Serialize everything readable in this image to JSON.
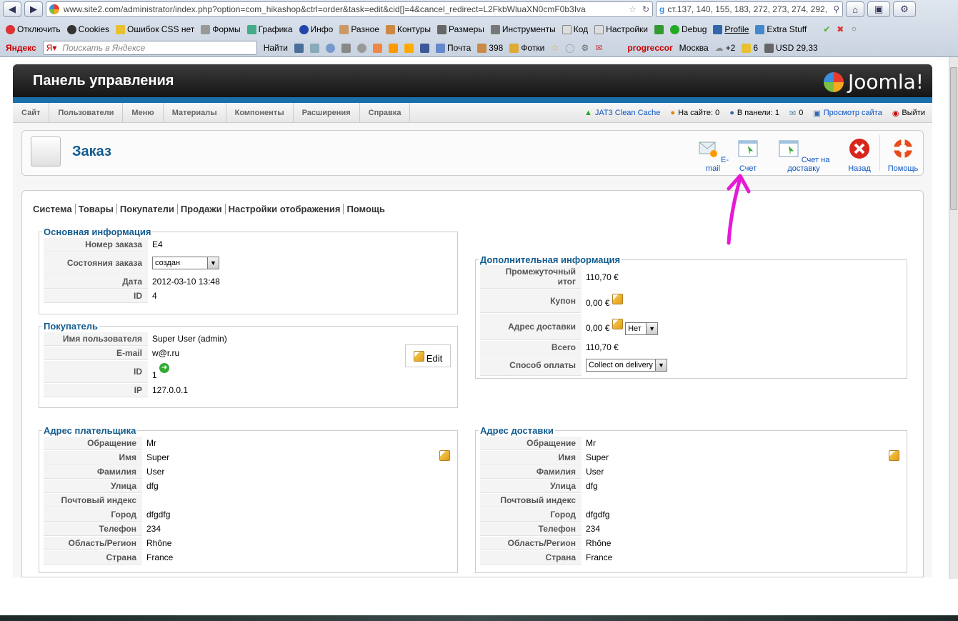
{
  "browser": {
    "url": "www.site2.com/administrator/index.php?option=com_hikashop&ctrl=order&task=edit&cid[]=4&cancel_redirect=L2FkbWluaXN0cmF0b3Iva",
    "search_value": "ст.137, 140, 155, 183, 272, 273, 274, 292,",
    "devbar": [
      "Отключить",
      "Cookies",
      "Ошибок CSS нет",
      "Формы",
      "Графика",
      "Инфо",
      "Разное",
      "Контуры",
      "Размеры",
      "Инструменты",
      "Код",
      "Настройки",
      "Debug",
      "Profile",
      "Extra Stuff"
    ],
    "yandex": {
      "brand": "Яндекс",
      "search_placeholder": "Поискать в Яндексе",
      "find_label": "Найти",
      "mail_label": "Почта",
      "mail_count": "398",
      "photos_label": "Фотки",
      "user": "progreccor",
      "city": "Москва",
      "weather": "+2",
      "counter": "6",
      "currency": "USD 29,33"
    }
  },
  "admin": {
    "title": "Панель управления",
    "logo_text": "Joomla!",
    "menu": [
      "Сайт",
      "Пользователи",
      "Меню",
      "Материалы",
      "Компоненты",
      "Расширения",
      "Справка"
    ],
    "status": {
      "cache": "JAT3 Clean Cache",
      "on_site": "На сайте: 0",
      "in_panel": "В панели: 1",
      "messages": "0",
      "view_site": "Просмотр сайта",
      "logout": "Выйти"
    }
  },
  "toolbar": {
    "title": "Заказ",
    "buttons": [
      "E-mail",
      "Счет",
      "Счет на доставку",
      "Назад",
      "Помощь"
    ]
  },
  "tabs": [
    "Система",
    "Товары",
    "Покупатели",
    "Продажи",
    "Настройки отображения",
    "Помощь"
  ],
  "main_info": {
    "legend": "Основная информация",
    "rows": [
      {
        "label": "Номер заказа",
        "value": "E4"
      },
      {
        "label": "Состояния заказа",
        "value": "создан"
      },
      {
        "label": "Дата",
        "value": "2012-03-10 13:48"
      },
      {
        "label": "ID",
        "value": "4"
      }
    ]
  },
  "customer": {
    "legend": "Покупатель",
    "edit_label": "Edit",
    "rows": [
      {
        "label": "Имя пользователя",
        "value": "Super User (admin)"
      },
      {
        "label": "E-mail",
        "value": "w@r.ru"
      },
      {
        "label": "ID",
        "value": "1"
      },
      {
        "label": "IP",
        "value": "127.0.0.1"
      }
    ]
  },
  "extra_info": {
    "legend": "Дополнительная информация",
    "rows": [
      {
        "label": "Промежуточный итог",
        "value": "110,70 €"
      },
      {
        "label": "Купон",
        "value": "0,00 €"
      },
      {
        "label": "Адрес доставки",
        "value": "0,00 €",
        "select": "Нет"
      },
      {
        "label": "Всего",
        "value": "110,70 €"
      },
      {
        "label": "Способ оплаты",
        "value": "Collect on delivery"
      }
    ]
  },
  "billing": {
    "legend": "Адрес плательщика",
    "rows": [
      {
        "label": "Обращение",
        "value": "Mr"
      },
      {
        "label": "Имя",
        "value": "Super"
      },
      {
        "label": "Фамилия",
        "value": "User"
      },
      {
        "label": "Улица",
        "value": "dfg"
      },
      {
        "label": "Почтовый индекс",
        "value": ""
      },
      {
        "label": "Город",
        "value": "dfgdfg"
      },
      {
        "label": "Телефон",
        "value": "234"
      },
      {
        "label": "Область/Регион",
        "value": "Rhône"
      },
      {
        "label": "Страна",
        "value": "France"
      }
    ]
  },
  "shipping": {
    "legend": "Адрес доставки",
    "rows": [
      {
        "label": "Обращение",
        "value": "Mr"
      },
      {
        "label": "Имя",
        "value": "Super"
      },
      {
        "label": "Фамилия",
        "value": "User"
      },
      {
        "label": "Улица",
        "value": "dfg"
      },
      {
        "label": "Почтовый индекс",
        "value": ""
      },
      {
        "label": "Город",
        "value": "dfgdfg"
      },
      {
        "label": "Телефон",
        "value": "234"
      },
      {
        "label": "Область/Регион",
        "value": "Rhône"
      },
      {
        "label": "Страна",
        "value": "France"
      }
    ]
  },
  "colors": {
    "accent": "#135c8f",
    "annotation": "#e619d6"
  }
}
